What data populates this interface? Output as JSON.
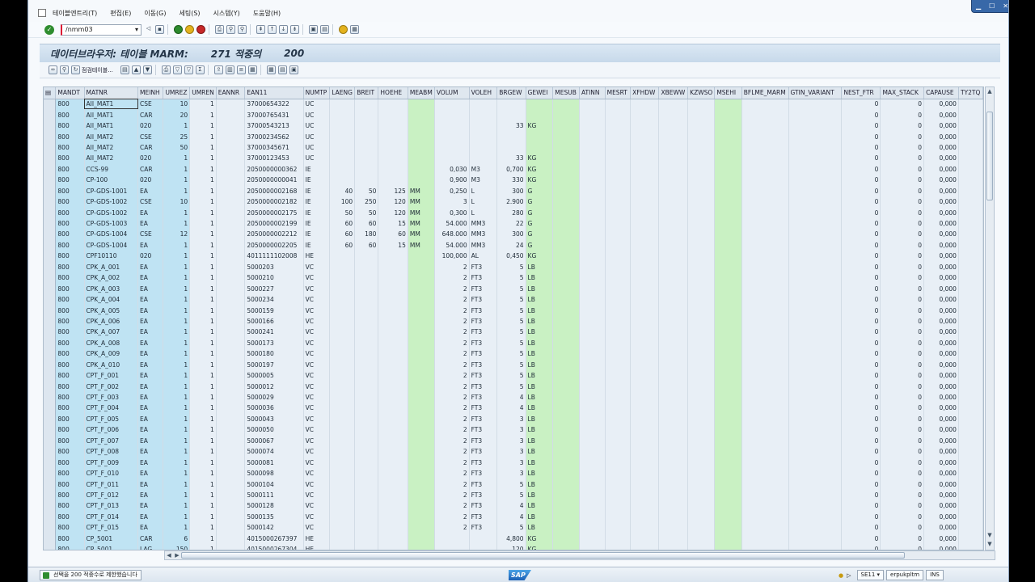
{
  "menu": {
    "items": [
      "테이블엔트리(T)",
      "편집(E)",
      "이동(G)",
      "세팅(S)",
      "시스템(Y)",
      "도움말(H)"
    ]
  },
  "toolbar": {
    "command_value": "/nmm03"
  },
  "title": {
    "prefix": "데이터브라우저: 테이블 MARM:",
    "count": "271 적중의",
    "max": "200"
  },
  "app_toolbar": {
    "check_table_label": "점검테이블..."
  },
  "table": {
    "columns": [
      "MANDT",
      "MATNR",
      "MEINH",
      "UMREZ",
      "UMREN",
      "EANNR",
      "EAN11",
      "NUMTP",
      "LAENG",
      "BREIT",
      "HOEHE",
      "MEABM",
      "VOLUM",
      "VOLEH",
      "BRGEW",
      "GEWEI",
      "MESUB",
      "ATINN",
      "MESRT",
      "XFHDW",
      "XBEWW",
      "KZWSO",
      "MSEHI",
      "BFLME_MARM",
      "GTIN_VARIANT",
      "NEST_FTR",
      "MAX_STACK",
      "CAPAUSE",
      "TY2TQ"
    ],
    "rows": [
      [
        "800",
        "AII_MAT1",
        "CSE",
        "10",
        "1",
        "",
        "37000654322",
        "UC",
        "",
        "",
        "",
        "",
        "",
        "",
        "",
        "",
        "",
        "",
        "",
        "",
        "",
        "",
        "",
        "",
        "",
        "0",
        "0",
        "0,000",
        ""
      ],
      [
        "800",
        "AII_MAT1",
        "CAR",
        "20",
        "1",
        "",
        "37000765431",
        "UC",
        "",
        "",
        "",
        "",
        "",
        "",
        "",
        "",
        "",
        "",
        "",
        "",
        "",
        "",
        "",
        "",
        "",
        "0",
        "0",
        "0,000",
        ""
      ],
      [
        "800",
        "AII_MAT1",
        "020",
        "1",
        "1",
        "",
        "37000543213",
        "UC",
        "",
        "",
        "",
        "",
        "",
        "",
        "33",
        "KG",
        "",
        "",
        "",
        "",
        "",
        "",
        "",
        "",
        "",
        "0",
        "0",
        "0,000",
        ""
      ],
      [
        "800",
        "AII_MAT2",
        "CSE",
        "25",
        "1",
        "",
        "37000234562",
        "UC",
        "",
        "",
        "",
        "",
        "",
        "",
        "",
        "",
        "",
        "",
        "",
        "",
        "",
        "",
        "",
        "",
        "",
        "0",
        "0",
        "0,000",
        ""
      ],
      [
        "800",
        "AII_MAT2",
        "CAR",
        "50",
        "1",
        "",
        "37000345671",
        "UC",
        "",
        "",
        "",
        "",
        "",
        "",
        "",
        "",
        "",
        "",
        "",
        "",
        "",
        "",
        "",
        "",
        "",
        "0",
        "0",
        "0,000",
        ""
      ],
      [
        "800",
        "AII_MAT2",
        "020",
        "1",
        "1",
        "",
        "37000123453",
        "UC",
        "",
        "",
        "",
        "",
        "",
        "",
        "33",
        "KG",
        "",
        "",
        "",
        "",
        "",
        "",
        "",
        "",
        "",
        "0",
        "0",
        "0,000",
        ""
      ],
      [
        "800",
        "CCS-99",
        "CAR",
        "1",
        "1",
        "",
        "2050000000362",
        "IE",
        "",
        "",
        "",
        "",
        "0,030",
        "M3",
        "0,700",
        "KG",
        "",
        "",
        "",
        "",
        "",
        "",
        "",
        "",
        "",
        "0",
        "0",
        "0,000",
        ""
      ],
      [
        "800",
        "CP-100",
        "020",
        "1",
        "1",
        "",
        "2050000000041",
        "IE",
        "",
        "",
        "",
        "",
        "0,900",
        "M3",
        "330",
        "KG",
        "",
        "",
        "",
        "",
        "",
        "",
        "",
        "",
        "",
        "0",
        "0",
        "0,000",
        ""
      ],
      [
        "800",
        "CP-GDS-1001",
        "EA",
        "1",
        "1",
        "",
        "2050000002168",
        "IE",
        "40",
        "50",
        "125",
        "MM",
        "0,250",
        "L",
        "300",
        "G",
        "",
        "",
        "",
        "",
        "",
        "",
        "",
        "",
        "",
        "0",
        "0",
        "0,000",
        ""
      ],
      [
        "800",
        "CP-GDS-1002",
        "CSE",
        "10",
        "1",
        "",
        "2050000002182",
        "IE",
        "100",
        "250",
        "120",
        "MM",
        "3",
        "L",
        "2.900",
        "G",
        "",
        "",
        "",
        "",
        "",
        "",
        "",
        "",
        "",
        "0",
        "0",
        "0,000",
        ""
      ],
      [
        "800",
        "CP-GDS-1002",
        "EA",
        "1",
        "1",
        "",
        "2050000002175",
        "IE",
        "50",
        "50",
        "120",
        "MM",
        "0,300",
        "L",
        "280",
        "G",
        "",
        "",
        "",
        "",
        "",
        "",
        "",
        "",
        "",
        "0",
        "0",
        "0,000",
        ""
      ],
      [
        "800",
        "CP-GDS-1003",
        "EA",
        "1",
        "1",
        "",
        "2050000002199",
        "IE",
        "60",
        "60",
        "15",
        "MM",
        "54.000",
        "MM3",
        "22",
        "G",
        "",
        "",
        "",
        "",
        "",
        "",
        "",
        "",
        "",
        "0",
        "0",
        "0,000",
        ""
      ],
      [
        "800",
        "CP-GDS-1004",
        "CSE",
        "12",
        "1",
        "",
        "2050000002212",
        "IE",
        "60",
        "180",
        "60",
        "MM",
        "648.000",
        "MM3",
        "300",
        "G",
        "",
        "",
        "",
        "",
        "",
        "",
        "",
        "",
        "",
        "0",
        "0",
        "0,000",
        ""
      ],
      [
        "800",
        "CP-GDS-1004",
        "EA",
        "1",
        "1",
        "",
        "2050000002205",
        "IE",
        "60",
        "60",
        "15",
        "MM",
        "54.000",
        "MM3",
        "24",
        "G",
        "",
        "",
        "",
        "",
        "",
        "",
        "",
        "",
        "",
        "0",
        "0",
        "0,000",
        ""
      ],
      [
        "800",
        "CPF10110",
        "020",
        "1",
        "1",
        "",
        "4011111102008",
        "HE",
        "",
        "",
        "",
        "",
        "100,000",
        "AL",
        "0,450",
        "KG",
        "",
        "",
        "",
        "",
        "",
        "",
        "",
        "",
        "",
        "0",
        "0",
        "0,000",
        ""
      ],
      [
        "800",
        "CPK_A_001",
        "EA",
        "1",
        "1",
        "",
        "5000203",
        "VC",
        "",
        "",
        "",
        "",
        "2",
        "FT3",
        "5",
        "LB",
        "",
        "",
        "",
        "",
        "",
        "",
        "",
        "",
        "",
        "0",
        "0",
        "0,000",
        ""
      ],
      [
        "800",
        "CPK_A_002",
        "EA",
        "1",
        "1",
        "",
        "5000210",
        "VC",
        "",
        "",
        "",
        "",
        "2",
        "FT3",
        "5",
        "LB",
        "",
        "",
        "",
        "",
        "",
        "",
        "",
        "",
        "",
        "0",
        "0",
        "0,000",
        ""
      ],
      [
        "800",
        "CPK_A_003",
        "EA",
        "1",
        "1",
        "",
        "5000227",
        "VC",
        "",
        "",
        "",
        "",
        "2",
        "FT3",
        "5",
        "LB",
        "",
        "",
        "",
        "",
        "",
        "",
        "",
        "",
        "",
        "0",
        "0",
        "0,000",
        ""
      ],
      [
        "800",
        "CPK_A_004",
        "EA",
        "1",
        "1",
        "",
        "5000234",
        "VC",
        "",
        "",
        "",
        "",
        "2",
        "FT3",
        "5",
        "LB",
        "",
        "",
        "",
        "",
        "",
        "",
        "",
        "",
        "",
        "0",
        "0",
        "0,000",
        ""
      ],
      [
        "800",
        "CPK_A_005",
        "EA",
        "1",
        "1",
        "",
        "5000159",
        "VC",
        "",
        "",
        "",
        "",
        "2",
        "FT3",
        "5",
        "LB",
        "",
        "",
        "",
        "",
        "",
        "",
        "",
        "",
        "",
        "0",
        "0",
        "0,000",
        ""
      ],
      [
        "800",
        "CPK_A_006",
        "EA",
        "1",
        "1",
        "",
        "5000166",
        "VC",
        "",
        "",
        "",
        "",
        "2",
        "FT3",
        "5",
        "LB",
        "",
        "",
        "",
        "",
        "",
        "",
        "",
        "",
        "",
        "0",
        "0",
        "0,000",
        ""
      ],
      [
        "800",
        "CPK_A_007",
        "EA",
        "1",
        "1",
        "",
        "5000241",
        "VC",
        "",
        "",
        "",
        "",
        "2",
        "FT3",
        "5",
        "LB",
        "",
        "",
        "",
        "",
        "",
        "",
        "",
        "",
        "",
        "0",
        "0",
        "0,000",
        ""
      ],
      [
        "800",
        "CPK_A_008",
        "EA",
        "1",
        "1",
        "",
        "5000173",
        "VC",
        "",
        "",
        "",
        "",
        "2",
        "FT3",
        "5",
        "LB",
        "",
        "",
        "",
        "",
        "",
        "",
        "",
        "",
        "",
        "0",
        "0",
        "0,000",
        ""
      ],
      [
        "800",
        "CPK_A_009",
        "EA",
        "1",
        "1",
        "",
        "5000180",
        "VC",
        "",
        "",
        "",
        "",
        "2",
        "FT3",
        "5",
        "LB",
        "",
        "",
        "",
        "",
        "",
        "",
        "",
        "",
        "",
        "0",
        "0",
        "0,000",
        ""
      ],
      [
        "800",
        "CPK_A_010",
        "EA",
        "1",
        "1",
        "",
        "5000197",
        "VC",
        "",
        "",
        "",
        "",
        "2",
        "FT3",
        "5",
        "LB",
        "",
        "",
        "",
        "",
        "",
        "",
        "",
        "",
        "",
        "0",
        "0",
        "0,000",
        ""
      ],
      [
        "800",
        "CPT_F_001",
        "EA",
        "1",
        "1",
        "",
        "5000005",
        "VC",
        "",
        "",
        "",
        "",
        "2",
        "FT3",
        "5",
        "LB",
        "",
        "",
        "",
        "",
        "",
        "",
        "",
        "",
        "",
        "0",
        "0",
        "0,000",
        ""
      ],
      [
        "800",
        "CPT_F_002",
        "EA",
        "1",
        "1",
        "",
        "5000012",
        "VC",
        "",
        "",
        "",
        "",
        "2",
        "FT3",
        "5",
        "LB",
        "",
        "",
        "",
        "",
        "",
        "",
        "",
        "",
        "",
        "0",
        "0",
        "0,000",
        ""
      ],
      [
        "800",
        "CPT_F_003",
        "EA",
        "1",
        "1",
        "",
        "5000029",
        "VC",
        "",
        "",
        "",
        "",
        "2",
        "FT3",
        "4",
        "LB",
        "",
        "",
        "",
        "",
        "",
        "",
        "",
        "",
        "",
        "0",
        "0",
        "0,000",
        ""
      ],
      [
        "800",
        "CPT_F_004",
        "EA",
        "1",
        "1",
        "",
        "5000036",
        "VC",
        "",
        "",
        "",
        "",
        "2",
        "FT3",
        "4",
        "LB",
        "",
        "",
        "",
        "",
        "",
        "",
        "",
        "",
        "",
        "0",
        "0",
        "0,000",
        ""
      ],
      [
        "800",
        "CPT_F_005",
        "EA",
        "1",
        "1",
        "",
        "5000043",
        "VC",
        "",
        "",
        "",
        "",
        "2",
        "FT3",
        "3",
        "LB",
        "",
        "",
        "",
        "",
        "",
        "",
        "",
        "",
        "",
        "0",
        "0",
        "0,000",
        ""
      ],
      [
        "800",
        "CPT_F_006",
        "EA",
        "1",
        "1",
        "",
        "5000050",
        "VC",
        "",
        "",
        "",
        "",
        "2",
        "FT3",
        "3",
        "LB",
        "",
        "",
        "",
        "",
        "",
        "",
        "",
        "",
        "",
        "0",
        "0",
        "0,000",
        ""
      ],
      [
        "800",
        "CPT_F_007",
        "EA",
        "1",
        "1",
        "",
        "5000067",
        "VC",
        "",
        "",
        "",
        "",
        "2",
        "FT3",
        "3",
        "LB",
        "",
        "",
        "",
        "",
        "",
        "",
        "",
        "",
        "",
        "0",
        "0",
        "0,000",
        ""
      ],
      [
        "800",
        "CPT_F_008",
        "EA",
        "1",
        "1",
        "",
        "5000074",
        "VC",
        "",
        "",
        "",
        "",
        "2",
        "FT3",
        "3",
        "LB",
        "",
        "",
        "",
        "",
        "",
        "",
        "",
        "",
        "",
        "0",
        "0",
        "0,000",
        ""
      ],
      [
        "800",
        "CPT_F_009",
        "EA",
        "1",
        "1",
        "",
        "5000081",
        "VC",
        "",
        "",
        "",
        "",
        "2",
        "FT3",
        "3",
        "LB",
        "",
        "",
        "",
        "",
        "",
        "",
        "",
        "",
        "",
        "0",
        "0",
        "0,000",
        ""
      ],
      [
        "800",
        "CPT_F_010",
        "EA",
        "1",
        "1",
        "",
        "5000098",
        "VC",
        "",
        "",
        "",
        "",
        "2",
        "FT3",
        "3",
        "LB",
        "",
        "",
        "",
        "",
        "",
        "",
        "",
        "",
        "",
        "0",
        "0",
        "0,000",
        ""
      ],
      [
        "800",
        "CPT_F_011",
        "EA",
        "1",
        "1",
        "",
        "5000104",
        "VC",
        "",
        "",
        "",
        "",
        "2",
        "FT3",
        "5",
        "LB",
        "",
        "",
        "",
        "",
        "",
        "",
        "",
        "",
        "",
        "0",
        "0",
        "0,000",
        ""
      ],
      [
        "800",
        "CPT_F_012",
        "EA",
        "1",
        "1",
        "",
        "5000111",
        "VC",
        "",
        "",
        "",
        "",
        "2",
        "FT3",
        "5",
        "LB",
        "",
        "",
        "",
        "",
        "",
        "",
        "",
        "",
        "",
        "0",
        "0",
        "0,000",
        ""
      ],
      [
        "800",
        "CPT_F_013",
        "EA",
        "1",
        "1",
        "",
        "5000128",
        "VC",
        "",
        "",
        "",
        "",
        "2",
        "FT3",
        "4",
        "LB",
        "",
        "",
        "",
        "",
        "",
        "",
        "",
        "",
        "",
        "0",
        "0",
        "0,000",
        ""
      ],
      [
        "800",
        "CPT_F_014",
        "EA",
        "1",
        "1",
        "",
        "5000135",
        "VC",
        "",
        "",
        "",
        "",
        "2",
        "FT3",
        "4",
        "LB",
        "",
        "",
        "",
        "",
        "",
        "",
        "",
        "",
        "",
        "0",
        "0",
        "0,000",
        ""
      ],
      [
        "800",
        "CPT_F_015",
        "EA",
        "1",
        "1",
        "",
        "5000142",
        "VC",
        "",
        "",
        "",
        "",
        "2",
        "FT3",
        "5",
        "LB",
        "",
        "",
        "",
        "",
        "",
        "",
        "",
        "",
        "",
        "0",
        "0",
        "0,000",
        ""
      ],
      [
        "800",
        "CP_5001",
        "CAR",
        "6",
        "1",
        "",
        "4015000267397",
        "HE",
        "",
        "",
        "",
        "",
        "",
        "",
        "4,800",
        "KG",
        "",
        "",
        "",
        "",
        "",
        "",
        "",
        "",
        "",
        "0",
        "0",
        "0,000",
        ""
      ],
      [
        "800",
        "CP_5001",
        "LAG",
        "150",
        "1",
        "",
        "4015000267304",
        "HE",
        "",
        "",
        "",
        "",
        "",
        "",
        "120",
        "KG",
        "",
        "",
        "",
        "",
        "",
        "",
        "",
        "",
        "",
        "0",
        "0",
        "0,000",
        ""
      ]
    ]
  },
  "status": {
    "message": "선택을 200 적중수로 제한했습니다",
    "system": "SE11",
    "server": "erpukpltm",
    "mode": "INS"
  },
  "colors": {
    "key_column": "#bfe3f3",
    "empty_column": "#c9f1c3",
    "title_bar": "#c7d9ea"
  }
}
